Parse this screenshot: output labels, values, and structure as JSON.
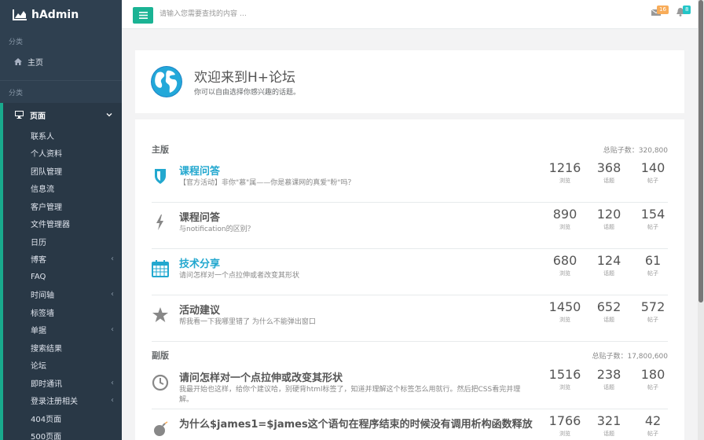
{
  "brand": {
    "name": "hAdmin"
  },
  "sidebar": {
    "section1": "分类",
    "home": "主页",
    "section2": "分类",
    "active": "页面",
    "items": [
      {
        "label": "联系人",
        "arrow": false
      },
      {
        "label": "个人资料",
        "arrow": false
      },
      {
        "label": "团队管理",
        "arrow": false
      },
      {
        "label": "信息流",
        "arrow": false
      },
      {
        "label": "客户管理",
        "arrow": false
      },
      {
        "label": "文件管理器",
        "arrow": false
      },
      {
        "label": "日历",
        "arrow": false
      },
      {
        "label": "博客",
        "arrow": true
      },
      {
        "label": "FAQ",
        "arrow": false
      },
      {
        "label": "时间轴",
        "arrow": true
      },
      {
        "label": "标签墙",
        "arrow": false
      },
      {
        "label": "单据",
        "arrow": true
      },
      {
        "label": "搜索结果",
        "arrow": false
      },
      {
        "label": "论坛",
        "arrow": false
      },
      {
        "label": "即时通讯",
        "arrow": true
      },
      {
        "label": "登录注册相关",
        "arrow": true
      },
      {
        "label": "404页面",
        "arrow": false
      },
      {
        "label": "500页面",
        "arrow": false
      }
    ]
  },
  "topbar": {
    "search_placeholder": "请输入您需要查找的内容 …",
    "messages_count": "16",
    "alerts_count": "8"
  },
  "welcome": {
    "title": "欢迎来到H+论坛",
    "subtitle": "你可以自由选择你感兴趣的话题。"
  },
  "forum": {
    "main": {
      "title": "主版",
      "total": "总贴子数：320,800",
      "rows": [
        {
          "icon": "shield-icon",
          "title": "课程问答",
          "link": true,
          "desc": "【官方活动】非你\"慕\"属——你是慕课网的真爱\"粉\"吗？",
          "views": "1216",
          "topics": "368",
          "posts": "140"
        },
        {
          "icon": "bolt-icon",
          "title": "课程问答",
          "link": false,
          "desc": "与notification的区别？",
          "views": "890",
          "topics": "120",
          "posts": "154"
        },
        {
          "icon": "calendar-icon",
          "title": "技术分享",
          "link": true,
          "desc": "请问怎样对一个点拉伸或者改变其形状",
          "views": "680",
          "topics": "124",
          "posts": "61"
        },
        {
          "icon": "star-icon",
          "title": "活动建议",
          "link": false,
          "desc": "帮我看一下我哪里错了 为什么不能弹出窗口",
          "views": "1450",
          "topics": "652",
          "posts": "572"
        }
      ]
    },
    "sub": {
      "title": "副版",
      "total": "总贴子数：17,800,600",
      "rows": [
        {
          "icon": "clock-icon",
          "title": "请问怎样对一个点拉伸或改变其形状",
          "link": false,
          "desc": "我最开始也这样，给你个建议哈，别硬背html标签了，知道并理解这个标签怎么用就行。然后把CSS看完并理解。",
          "views": "1516",
          "topics": "238",
          "posts": "180"
        },
        {
          "icon": "bomb-icon",
          "title": "为什么$james1=$james这个语句在程序结束的时候没有调用析构函数释放",
          "link": false,
          "desc": "",
          "views": "1766",
          "topics": "321",
          "posts": "42"
        }
      ]
    },
    "labels": {
      "views": "浏览",
      "topics": "话题",
      "posts": "帖子"
    }
  },
  "colors": {
    "accent": "#1ab394",
    "link": "#23a8cf",
    "sidebar": "#2f4050"
  }
}
